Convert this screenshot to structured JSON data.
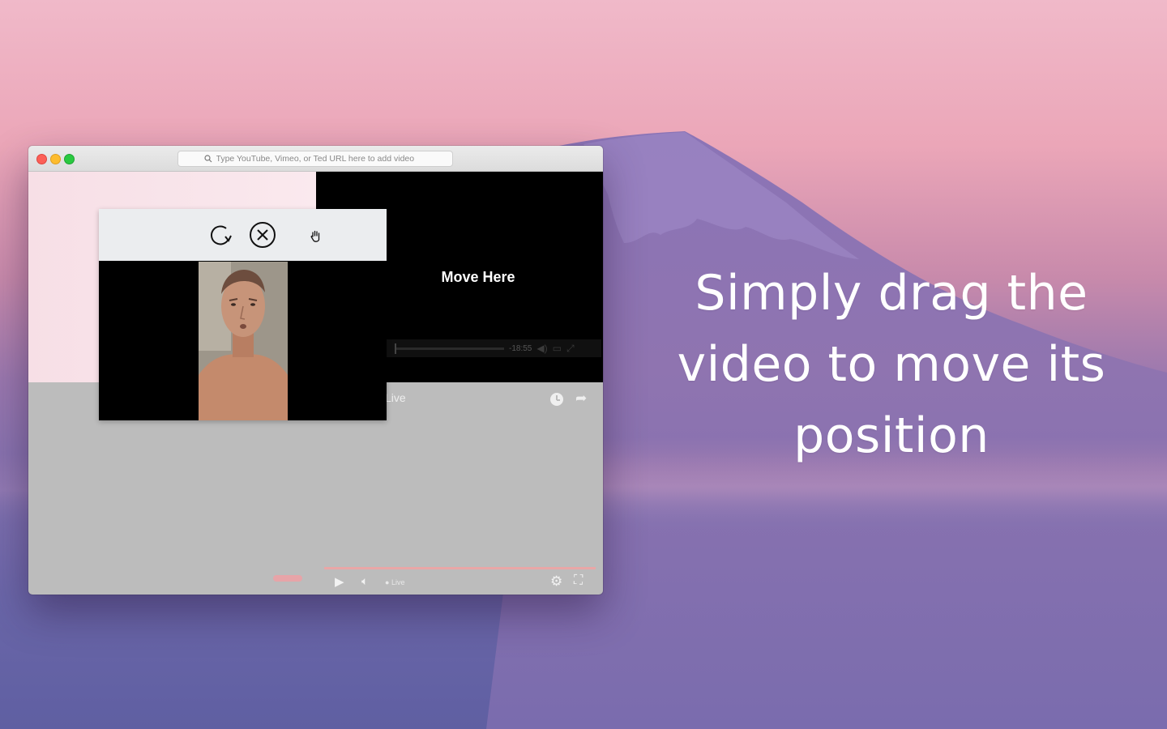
{
  "headline": "Simply drag the video to move its position",
  "window": {
    "search": {
      "placeholder": "Type YouTube, Vimeo, or Ted URL here to add video"
    },
    "player": {
      "overlay_text": "Move Here",
      "time_remaining": "-18:55",
      "live_label": "Live"
    },
    "bottom_controls": {
      "live_label": "Live"
    }
  },
  "mini_player": {
    "toolbar_icons": [
      "refresh-icon",
      "close-circle-icon",
      "hand-drag-icon"
    ]
  },
  "colors": {
    "accent_progress": "#e9a6a6",
    "close_red": "#fc5f57",
    "minimize_yellow": "#fdbc2e",
    "zoom_green": "#29c940"
  }
}
